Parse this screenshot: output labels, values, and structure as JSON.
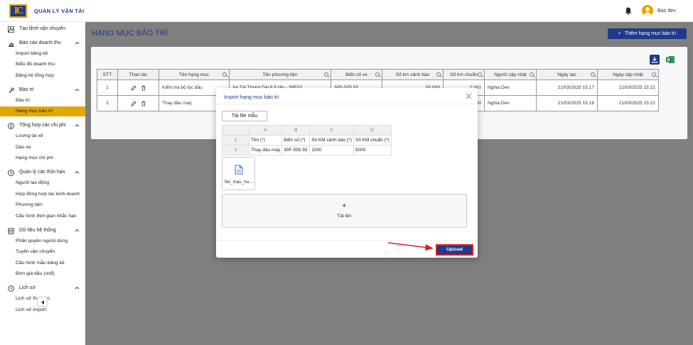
{
  "header": {
    "app_title": "QUẢN LÝ VẬN TẢI",
    "logo_text": "IC",
    "user_name": "Bao dev"
  },
  "sidebar": {
    "groups": [
      {
        "label": "Tạo lệnh vận chuyển",
        "icon": "route-icon",
        "items": []
      },
      {
        "label": "Báo cáo doanh thu",
        "icon": "bar-chart-icon",
        "items": [
          "Import bảng kê",
          "Biểu đồ doanh thu",
          "Bảng kê tổng hợp"
        ]
      },
      {
        "label": "Bảo trì",
        "icon": "wrench-icon",
        "items": [
          "Bảo trì",
          "Hạng mục bảo trì"
        ]
      },
      {
        "label": "Tổng hợp các chi phí",
        "icon": "dollar-icon",
        "items": [
          "Lương tài xế",
          "Dầu xe",
          "Hạng mục chi phí"
        ]
      },
      {
        "label": "Quản lý các thời hạn",
        "icon": "clock-icon",
        "items": [
          "Người lao động",
          "Hợp đồng hợp tác kinh doanh",
          "Phương tiện",
          "Cấu hình thời gian nhắc hạn"
        ]
      },
      {
        "label": "Dữ liệu hệ thống",
        "icon": "database-icon",
        "items": [
          "Phân quyền người dùng",
          "Tuyến vận chuyển",
          "Cấu hình mẫu bảng kê",
          "Đơn giá dầu (vnđ)"
        ]
      },
      {
        "label": "Lịch sử",
        "icon": "history-icon",
        "items": [
          "Lịch sử thao tác",
          "Lịch sử import"
        ]
      }
    ],
    "active_item": "Hạng mục bảo trì"
  },
  "main": {
    "page_title": "HẠNG MỤC BẢO TRÌ",
    "add_button": "Thêm hạng mục bảo trì",
    "table": {
      "columns": [
        "STT",
        "Thao tác",
        "Tên hạng mục",
        "Tên phương tiện",
        "Biển số xe",
        "Số km cảnh báo",
        "Số km chuẩn",
        "Người cập nhật",
        "Ngày tạo",
        "Ngày cập nhật"
      ],
      "rows": [
        {
          "stt": "1",
          "name": "Kiểm tra bộ lọc dầu",
          "vehicle": "Xe Tải Thùng Dài 8.5 tấn - 30E03",
          "plate": "30E-555.55",
          "warn_km": "50,000",
          "std_km": "2,000",
          "updater": "Nghia Dev",
          "created": "21/03/2025 15:17",
          "updated": "21/03/2025 15:22"
        },
        {
          "stt": "2",
          "name": "Thay dầu máy",
          "vehicle": "",
          "plate": "",
          "warn_km": "",
          "std_km": "2,000",
          "updater": "Nghia Dev",
          "created": "21/03/2025 15:16",
          "updated": "21/03/2025 15:22"
        }
      ]
    }
  },
  "modal": {
    "title": "Import hạng mục bảo trì",
    "template_button": "Tải file mẫu",
    "sheet": {
      "col_letters": [
        "A",
        "B",
        "C",
        "D"
      ],
      "rows": [
        {
          "num": "1",
          "cells": [
            "Tên (*)",
            "Biển số (*)",
            "Số KM cảnh báo (*)",
            "Số KM chuẩn (*)"
          ]
        },
        {
          "num": "2",
          "cells": [
            "Thay dầu máy",
            "30F-555.55",
            "1000",
            "5000"
          ]
        }
      ]
    },
    "file_name": "file_mau_hang_muc_bao_tri.xlsx",
    "drop_label": "Tải lên",
    "drop_plus": "+",
    "upload_button": "Upload"
  },
  "colors": {
    "primary": "#1f3a8a",
    "active": "#e0a800",
    "highlight": "#e02020",
    "excel": "#1d7a3e"
  }
}
